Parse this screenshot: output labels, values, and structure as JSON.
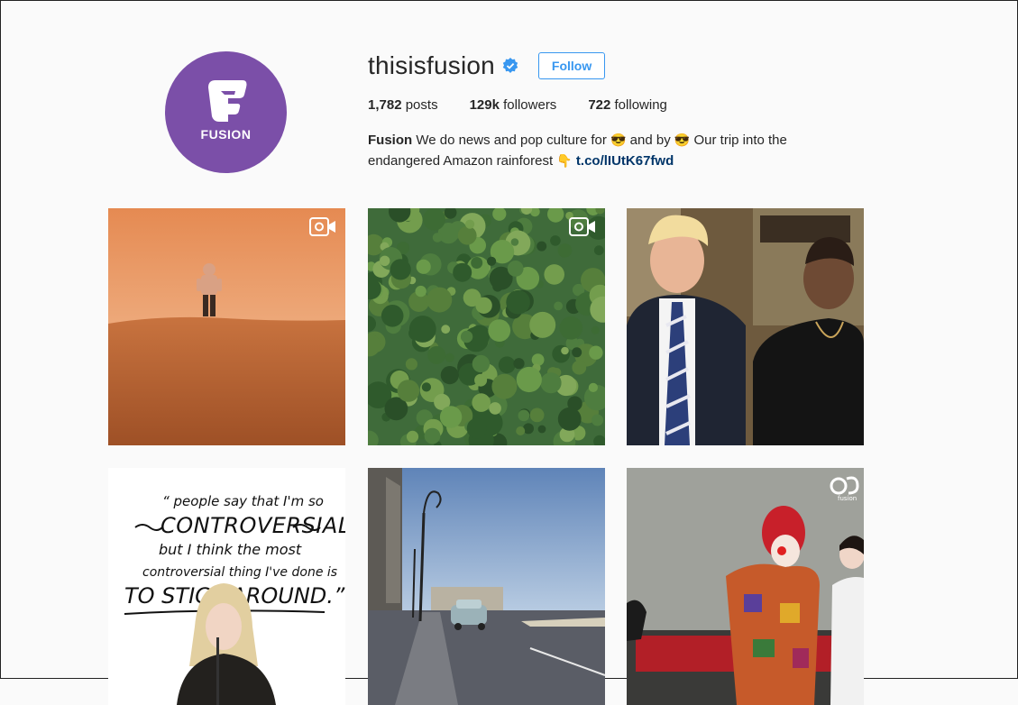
{
  "profile": {
    "username": "thisisfusion",
    "avatar_text": "FUSION",
    "follow_label": "Follow",
    "stats": [
      {
        "count": "1,782",
        "label": "posts"
      },
      {
        "count": "129k",
        "label": "followers"
      },
      {
        "count": "722",
        "label": "following"
      }
    ],
    "bio": {
      "name": "Fusion",
      "text_1": "We do news and pop culture for",
      "emoji_1": "😎",
      "text_2": "and by",
      "emoji_2": "😎",
      "text_3": "Our trip into the endangered Amazon rainforest",
      "emoji_3": "👇",
      "link": "t.co/lIUtK67fwd"
    }
  },
  "posts": [
    {
      "subject": "astronaut-desert",
      "video": true
    },
    {
      "subject": "amazon-rainforest",
      "video": true
    },
    {
      "subject": "two-men-photo",
      "video": false
    },
    {
      "subject": "madonna-quote",
      "video": false,
      "quote": [
        "“ people say that I'm so",
        "CONTROVERSIAL",
        "but I think the most",
        "controversial thing I've done is",
        "TO STICK AROUND.”"
      ]
    },
    {
      "subject": "havana-street",
      "video": false
    },
    {
      "subject": "clown-children",
      "video": false,
      "watermark": "fusion"
    }
  ],
  "colors": {
    "accent": "#3897f0",
    "avatar_bg": "#7b4fa8",
    "link": "#003569"
  }
}
